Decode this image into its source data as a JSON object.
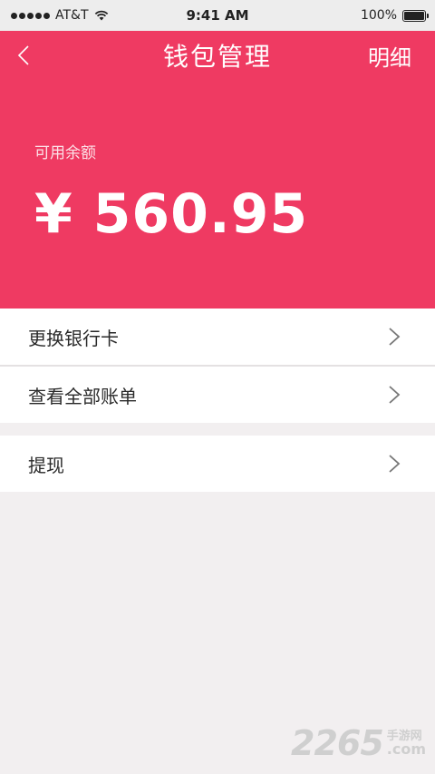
{
  "status_bar": {
    "carrier": "AT&T",
    "time": "9:41 AM",
    "battery_percent": "100%",
    "battery_level": 1.0
  },
  "nav": {
    "back_icon": "chevron-left-icon",
    "title": "钱包管理",
    "detail_label": "明细"
  },
  "balance": {
    "label": "可用余额",
    "amount": "¥ 560.95"
  },
  "menu_group_1": {
    "items": [
      {
        "label": "更换银行卡",
        "icon": "chevron-right-icon"
      },
      {
        "label": "查看全部账单",
        "icon": "chevron-right-icon"
      }
    ]
  },
  "menu_group_2": {
    "items": [
      {
        "label": "提现",
        "icon": "chevron-right-icon"
      }
    ]
  },
  "watermark": {
    "number": "2265",
    "cn": "手游网",
    "suffix": ".com"
  },
  "colors": {
    "brand": "#ef3a62",
    "background": "#f2eff0"
  }
}
